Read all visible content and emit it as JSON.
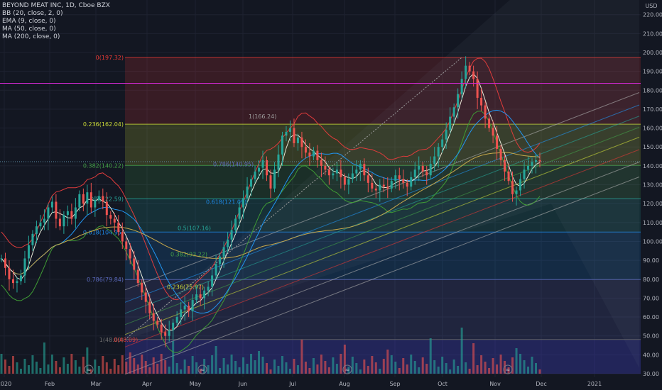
{
  "legend": {
    "symbol": "BEYOND MEAT INC, 1D, Cboe BZX",
    "indicators": [
      "BB (20, close, 2, 0)",
      "EMA (9, close, 0)",
      "MA (50, close, 0)",
      "MA (200, close, 0)"
    ]
  },
  "colors": {
    "background": "#131722",
    "up": "#26a69a",
    "down": "#ef5350",
    "bb": "#e03c3c",
    "bb_lower": "#3f9c35",
    "ema": "#e8e8d8",
    "ma50": "#2196f3",
    "ma200": "#c8a84a",
    "magenta": "#d028d0",
    "price_tag": "#5d8fa8"
  },
  "chart_data": {
    "type": "candlestick",
    "title": "BEYOND MEAT INC, 1D, Cboe BZX",
    "y_unit": "USD",
    "ylim": [
      30,
      225
    ],
    "y_ticks": [
      30,
      40,
      50,
      60,
      70,
      80,
      90,
      100,
      110,
      120,
      130,
      140,
      150,
      160,
      170,
      180,
      190,
      200,
      210,
      220
    ],
    "x_ticks": [
      "2020",
      "Feb",
      "Mar",
      "Apr",
      "May",
      "Jun",
      "Jul",
      "Aug",
      "Sep",
      "Oct",
      "Nov",
      "Dec",
      "2021"
    ],
    "last_price": "142.20",
    "horizontal_line": "183.67",
    "fib_retracement_main": [
      {
        "label": "0(197.32)",
        "price": 197.32
      },
      {
        "label": "0.236(162.04)",
        "price": 162.04
      },
      {
        "label": "0.382(140.22)",
        "price": 140.22
      },
      {
        "label": "0.5(122.59)",
        "price": 122.59
      },
      {
        "label": "0.618(104.95)",
        "price": 104.95
      },
      {
        "label": "0.786(79.84)",
        "price": 79.84
      },
      {
        "label": "1(48.09)",
        "price": 48.09
      }
    ],
    "fib_retracement_inner": [
      {
        "label": "1(166.24)",
        "price": 166.24
      },
      {
        "label": "0.786(140.95)",
        "price": 140.95
      },
      {
        "label": "0.618(121.09)",
        "price": 121.09
      },
      {
        "label": "0.5(107.16)",
        "price": 107.16
      },
      {
        "label": "0.382(93.22)",
        "price": 93.22
      },
      {
        "label": "0.236(75.97)",
        "price": 75.97
      },
      {
        "label": "0(48.09)",
        "price": 48.09
      }
    ],
    "volume_markers": [
      {
        "month": "Feb",
        "value": "≈"
      },
      {
        "month": "May",
        "value": "≈"
      },
      {
        "month": "Aug",
        "value": "≈"
      },
      {
        "month": "Nov",
        "value": "≈"
      }
    ],
    "closes": [
      91,
      86,
      80,
      78,
      79,
      82,
      91,
      98,
      104,
      108,
      110,
      112,
      118,
      121,
      112,
      108,
      114,
      116,
      112,
      118,
      125,
      120,
      126,
      118,
      122,
      124,
      121,
      114,
      112,
      110,
      105,
      100,
      96,
      91,
      85,
      78,
      73,
      68,
      62,
      58,
      56,
      52,
      50,
      53,
      57,
      60,
      64,
      66,
      63,
      69,
      72,
      70,
      74,
      76,
      82,
      88,
      92,
      97,
      101,
      106,
      112,
      118,
      123,
      129,
      133,
      137,
      139,
      143,
      135,
      128,
      138,
      146,
      156,
      158,
      160,
      152,
      155,
      150,
      147,
      145,
      148,
      143,
      140,
      138,
      135,
      136,
      138,
      134,
      130,
      133,
      136,
      138,
      141,
      135,
      131,
      128,
      127,
      130,
      129,
      128,
      132,
      135,
      133,
      131,
      129,
      134,
      138,
      140,
      137,
      135,
      141,
      145,
      150,
      154,
      159,
      166,
      171,
      178,
      186,
      193,
      190,
      186,
      176,
      172,
      165,
      160,
      156,
      149,
      143,
      137,
      132,
      125,
      127,
      133,
      138,
      140,
      142,
      143,
      142.2
    ]
  }
}
